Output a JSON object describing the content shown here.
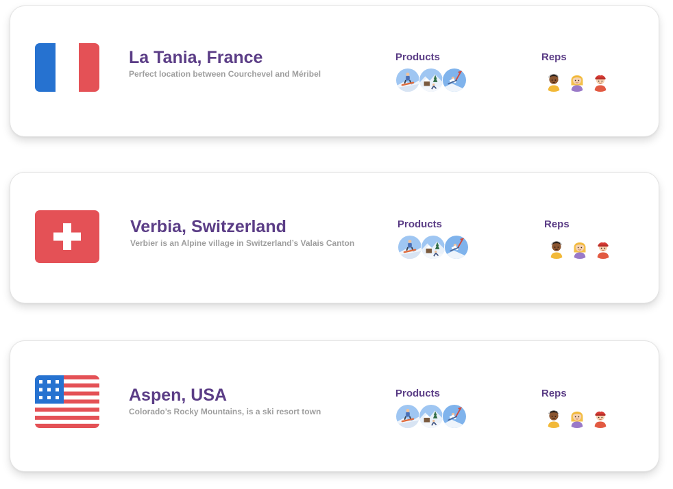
{
  "colors": {
    "title": "#5b3d86",
    "subtitle": "#9e9e9e",
    "france_blue": "#2672d0",
    "france_red": "#e45156",
    "swiss_red": "#e45156",
    "us_blue": "#2672d0",
    "us_red": "#e45156"
  },
  "locations": [
    {
      "flag": "france-flag-icon",
      "name": "La Tania, France",
      "description": "Perfect location between Courchevel and Méribel",
      "products_label": "Products",
      "reps_label": "Reps"
    },
    {
      "flag": "switzerland-flag-icon",
      "name": "Verbia, Switzerland",
      "description": "Verbier is an Alpine village in Switzerland’s Valais Canton",
      "products_label": "Products",
      "reps_label": "Reps"
    },
    {
      "flag": "usa-flag-icon",
      "name": "Aspen, USA",
      "description": "Colorado’s Rocky Mountains, is a ski resort town",
      "products_label": "Products",
      "reps_label": "Reps"
    }
  ],
  "product_icons": [
    "snowboarder-icon",
    "snow-village-icon",
    "ski-jump-icon"
  ],
  "rep_icons": [
    "rep-avatar-dark-hair-icon",
    "rep-avatar-blonde-icon",
    "rep-avatar-red-hat-icon"
  ]
}
